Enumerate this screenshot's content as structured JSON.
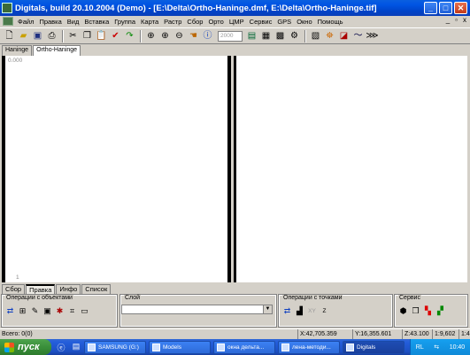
{
  "window": {
    "title": "Digitals, build 20.10.2004 (Demo) - [E:\\Delta\\Ortho-Haninge.dmf, E:\\Delta\\Ortho-Haninge.tif]",
    "minimize": "_",
    "maximize": "□",
    "close": "✕"
  },
  "menu": {
    "items": [
      "Файл",
      "Правка",
      "Вид",
      "Вставка",
      "Группа",
      "Карта",
      "Растр",
      "Сбор",
      "Орто",
      "ЦМР",
      "Сервис",
      "GPS",
      "Окно",
      "Помощь"
    ],
    "mdi_min": "_",
    "mdi_restore": "▫",
    "mdi_close": "x"
  },
  "toolbar": {
    "zoom_value": "2000"
  },
  "doc_tabs": [
    "Haninge",
    "Ortho-Haninge"
  ],
  "view": {
    "top_coord": "0.000",
    "bottom_coord": "1"
  },
  "panel_tabs": [
    "Сбор",
    "Правка",
    "Инфо",
    "Список"
  ],
  "panel": {
    "object_ops": "Операции с объектами",
    "layer": "Слой",
    "layer_value": "",
    "point_ops": "Операции с точками",
    "point_xy": "XY",
    "point_z": "Z",
    "service": "Сервис"
  },
  "status": {
    "total": "Всего: 0(0)",
    "x": "X:42,705.359",
    "y": "Y:16,355.601",
    "z": "Z:43.100",
    "scale": "1:9,602",
    "ratio": "1:4"
  },
  "taskbar": {
    "start": "пуск",
    "items": [
      "SAMSUNG (G:)",
      "Models",
      "окна дельта...",
      "лена-методи...",
      "Digitals"
    ],
    "lang": "RL",
    "time": "10:40"
  },
  "colors": {
    "titlebar": "#0054e3",
    "taskbar": "#245edb",
    "start": "#3a8f3a"
  }
}
